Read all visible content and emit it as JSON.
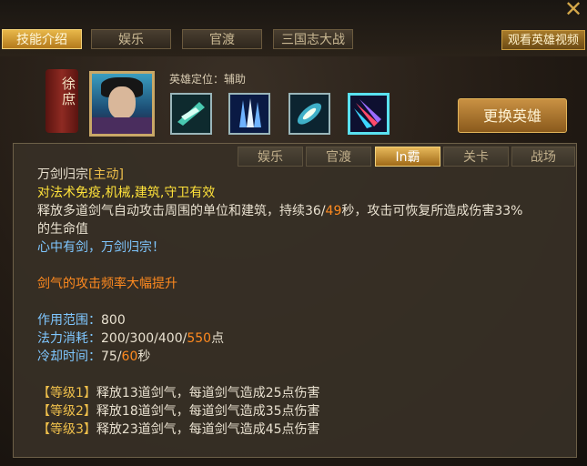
{
  "top_tabs": [
    "技能介绍",
    "娱乐",
    "官渡",
    "三国志大战"
  ],
  "close_symbol": "✕",
  "watch_video": "观看英雄视频",
  "hero": {
    "name": "徐庶",
    "role": "英雄定位：辅助"
  },
  "swap_hero": "更换英雄",
  "sub_tabs": [
    "娱乐",
    "官渡",
    "In霸",
    "关卡",
    "战场"
  ],
  "skill": {
    "name": "万剑归宗",
    "type": "[主动]",
    "immunity": "对法术免疫,机械,建筑,守卫有效",
    "desc_a": "释放多道剑气自动攻击周围的单位和建筑，持续36/",
    "desc_b": "49",
    "desc_c": "秒，攻击可恢复所造成伤害33%",
    "desc_line2": "的生命值",
    "quote": "心中有剑，万剑归宗！",
    "bonus": "剑气的攻击频率大幅提升",
    "range_label": "作用范围：",
    "range_value": "800",
    "mana_label": "法力消耗：",
    "mana_value": "200/300/400/",
    "mana_value_hi": "550",
    "mana_unit": "点",
    "cd_label": "冷却时间：",
    "cd_value": "75/",
    "cd_value_hi": "60",
    "cd_unit": "秒",
    "levels": [
      {
        "tag": "【等级1】",
        "text": "释放13道剑气，每道剑气造成25点伤害"
      },
      {
        "tag": "【等级2】",
        "text": "释放18道剑气，每道剑气造成35点伤害"
      },
      {
        "tag": "【等级3】",
        "text": "释放23道剑气，每道剑气造成45点伤害"
      }
    ]
  },
  "icons": [
    "close-icon",
    "hero-portrait",
    "skill-icon-1",
    "skill-icon-2",
    "skill-icon-3",
    "skill-icon-4"
  ],
  "colors": {
    "accent": "#e8b84a",
    "highlight": "#ff8a1f",
    "immunity": "#ffe23a",
    "quote": "#7fc7ff"
  }
}
